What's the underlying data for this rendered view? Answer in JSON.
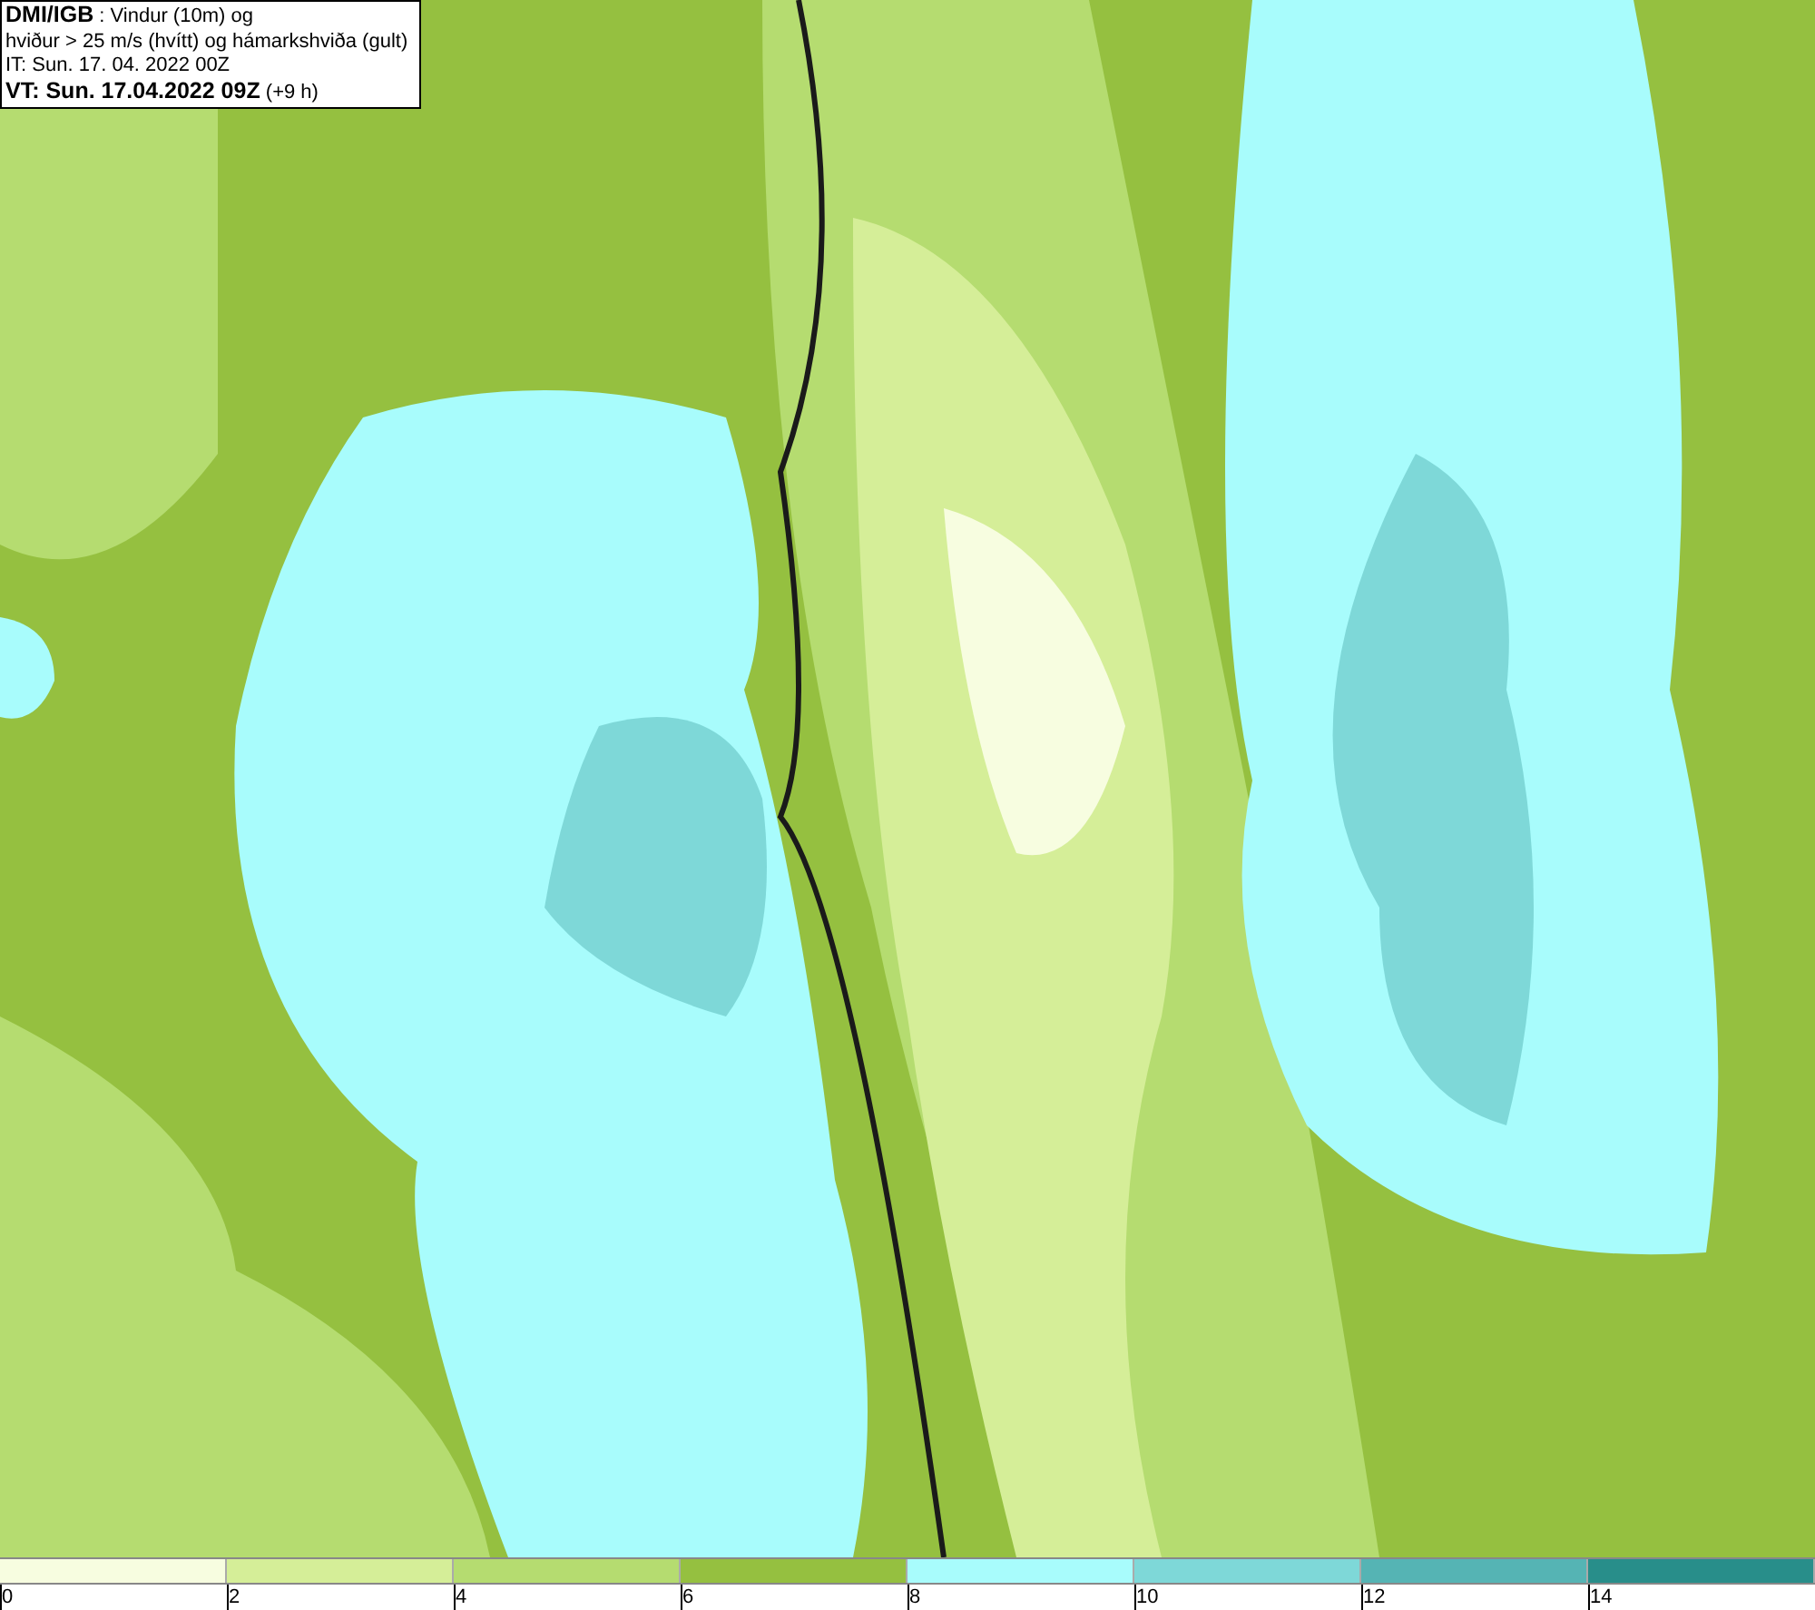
{
  "info_box": {
    "lines": [
      "**DMI/IGB** : Vindur (10m) og",
      "hviður > 25 m/s (hvítt) og hámarkshviða (gult)",
      "IT: Sun. 17. 04. 2022 00Z",
      "**VT: Sun. 17.04.2022 09Z** (+9 h)"
    ]
  },
  "legend": {
    "segments": [
      {
        "color": "#f7fde0"
      },
      {
        "color": "#d5ee98"
      },
      {
        "color": "#b5dc70"
      },
      {
        "color": "#95c040"
      },
      {
        "color": "#a8fcfc"
      },
      {
        "color": "#7ed8d8"
      },
      {
        "color": "#55b4b4"
      },
      {
        "color": "#288e8a"
      }
    ],
    "ticks": [
      "0",
      "2",
      "4",
      "6",
      "8",
      "10",
      "12",
      "14"
    ]
  }
}
